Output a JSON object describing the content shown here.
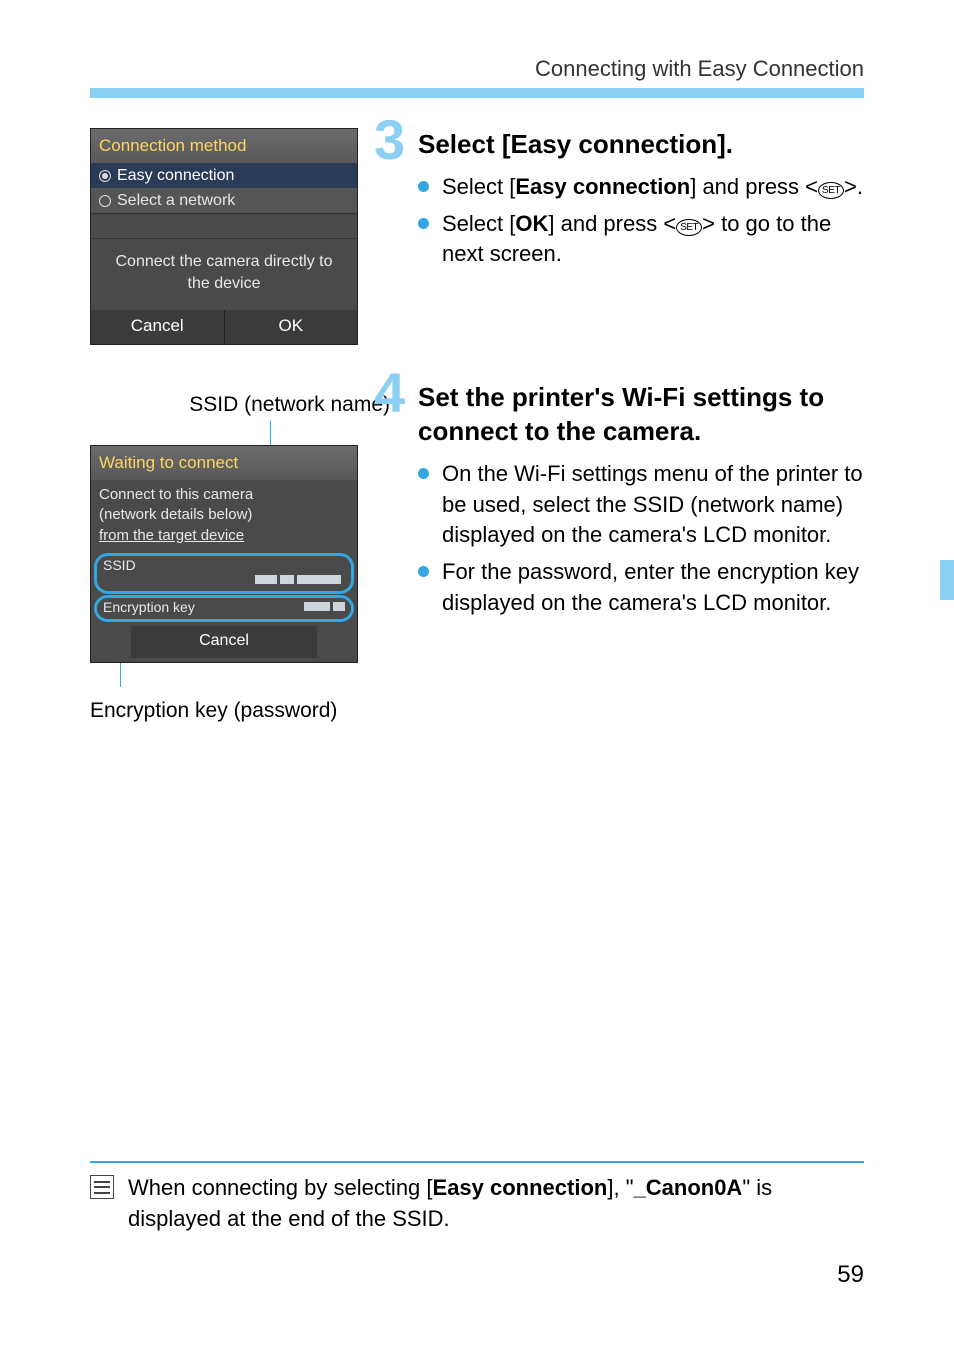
{
  "header": {
    "title": "Connecting with Easy Connection"
  },
  "step3": {
    "number": "3",
    "title": "Select [Easy connection].",
    "bullets": {
      "b1": {
        "pre": "Select [",
        "bold": "Easy connection",
        "post": "] and press <",
        "post2": ">."
      },
      "b2": {
        "pre": "Select [",
        "bold": "OK",
        "mid": "] and press <",
        "post": "> to go to the next screen."
      }
    },
    "lcd": {
      "title": "Connection method",
      "option_selected": "Easy connection",
      "option_other": "Select a network",
      "message_l1": "Connect the camera directly to",
      "message_l2": "the device",
      "btn_cancel": "Cancel",
      "btn_ok": "OK"
    }
  },
  "set_icon_text": "SET",
  "caption_ssid": "SSID (network name)",
  "caption_key": "Encryption key (password)",
  "step4": {
    "number": "4",
    "title": "Set the printer's Wi-Fi settings to connect to the camera.",
    "bullets": {
      "b1": "On the Wi-Fi settings menu of the printer to be used, select the SSID (network name) displayed on the camera's LCD monitor.",
      "b2": "For the password, enter the encryption key displayed on the camera's LCD monitor."
    },
    "lcd": {
      "title": "Waiting to connect",
      "info_l1": "Connect to this camera",
      "info_l2": "(network details below)",
      "info_l3": "from the target device",
      "field_ssid": "SSID",
      "field_key": "Encryption key",
      "cancel": "Cancel"
    }
  },
  "note": {
    "pre": "When connecting by selecting [",
    "bold1": "Easy connection",
    "mid": "], \"",
    "bold2": "_Canon0A",
    "post": "\" is displayed at the end of the SSID."
  },
  "page_number": "59"
}
